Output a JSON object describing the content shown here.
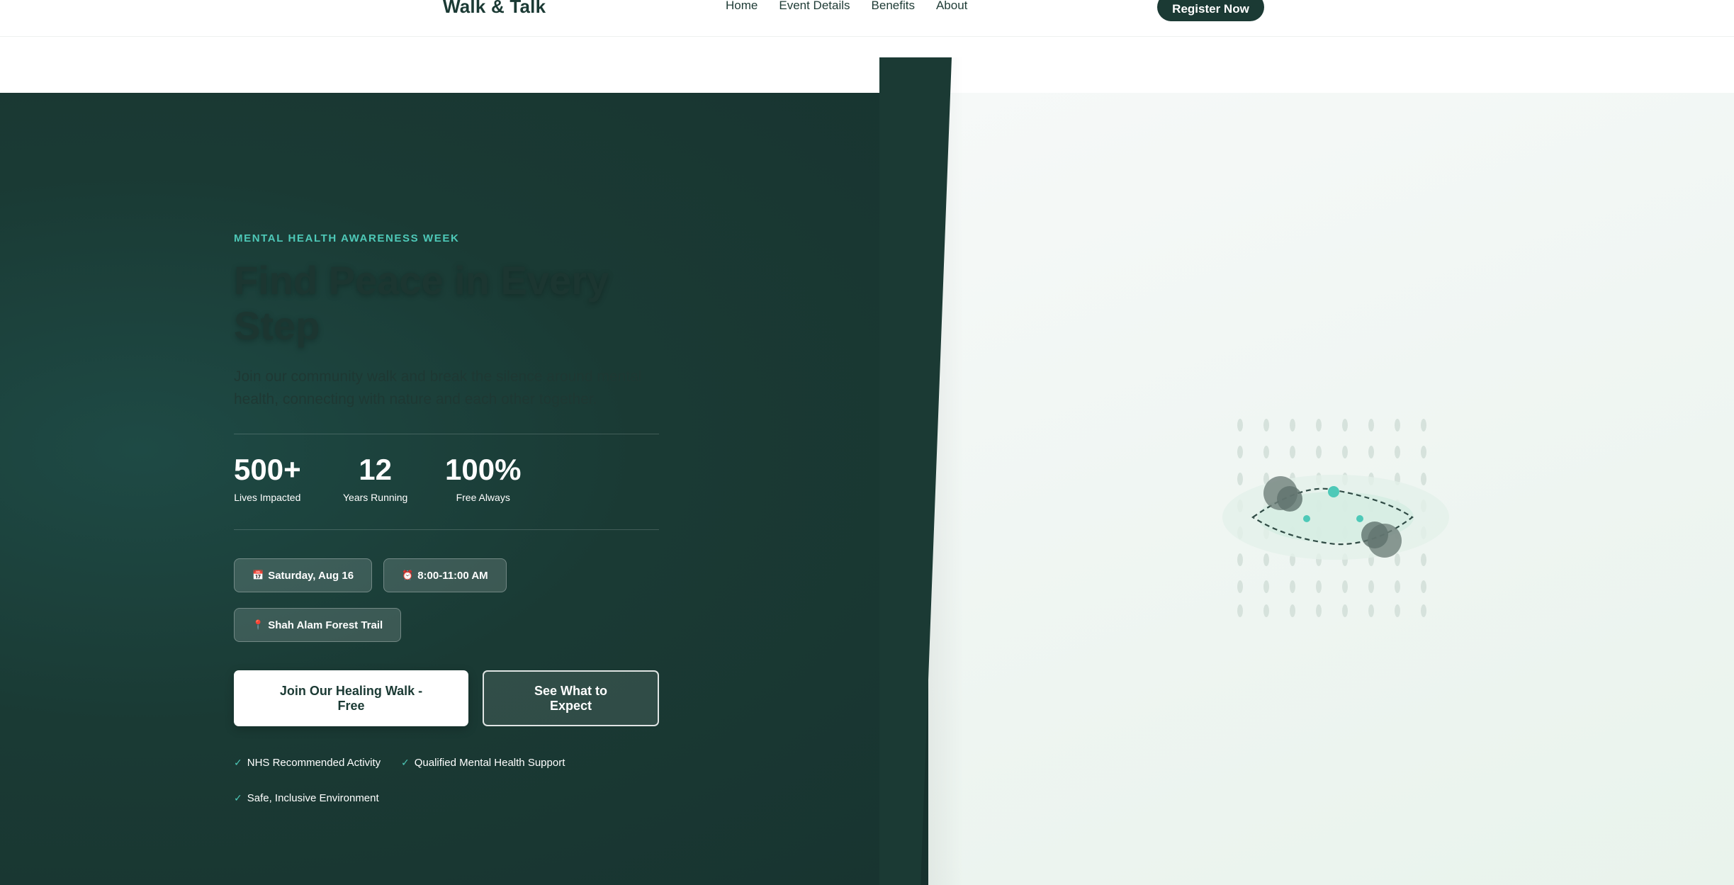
{
  "header": {
    "logo": "Walk & Talk",
    "nav": [
      "Home",
      "Event Details",
      "Benefits",
      "About"
    ],
    "cta": "Register Now"
  },
  "hero": {
    "eyebrow": "MENTAL HEALTH AWARENESS WEEK",
    "title": "Find Peace in Every Step",
    "subtitle": "Join our community walk and break the silence around mental health, connecting with nature and each other together.",
    "stats": [
      {
        "value": "500+",
        "label": "Lives Impacted"
      },
      {
        "value": "12",
        "label": "Years Running"
      },
      {
        "value": "100%",
        "label": "Free Always"
      }
    ],
    "chips": [
      {
        "icon": "calendar-icon",
        "glyph": "📅",
        "label": "Saturday, Aug 16"
      },
      {
        "icon": "alarm-clock-icon",
        "glyph": "⏰",
        "label": "8:00-11:00 AM"
      },
      {
        "icon": "pin-icon",
        "glyph": "📍",
        "label": "Shah Alam Forest Trail"
      }
    ],
    "primary_cta": "Join Our Healing Walk - Free",
    "secondary_cta": "See What to Expect",
    "checks": [
      "NHS Recommended Activity",
      "Qualified Mental Health Support",
      "Safe, Inclusive Environment"
    ]
  },
  "colors": {
    "dark_green": "#1b3a34",
    "accent_teal": "#4ec9b8",
    "light_bg": "#eef5f1"
  }
}
